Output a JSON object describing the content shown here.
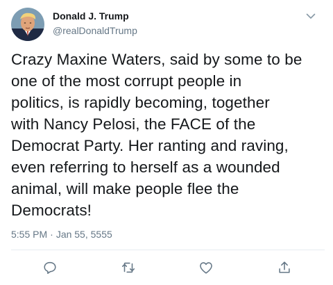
{
  "tweet": {
    "author_name": "Donald J. Trump",
    "author_handle": "@realDonaldTrump",
    "text_lines": [
      "Crazy Maxine Waters, said by some to be",
      "one of the most corrupt people in",
      "politics, is rapidly becoming, together",
      "with Nancy Pelosi, the FACE of the",
      "Democrat Party. Her ranting and raving,",
      "even referring to herself as a wounded",
      "animal, will make people flee the",
      "Democrats!"
    ],
    "time": "5:55 PM",
    "date": "Jan 55, 5555",
    "separator": "·"
  },
  "icons": {
    "menu": "chevron-down-icon",
    "reply": "reply-icon",
    "retweet": "retweet-icon",
    "like": "heart-icon",
    "share": "share-icon"
  },
  "colors": {
    "text": "#14171a",
    "secondary": "#657786",
    "icon": "#657786",
    "divider": "#e6ecf0"
  }
}
